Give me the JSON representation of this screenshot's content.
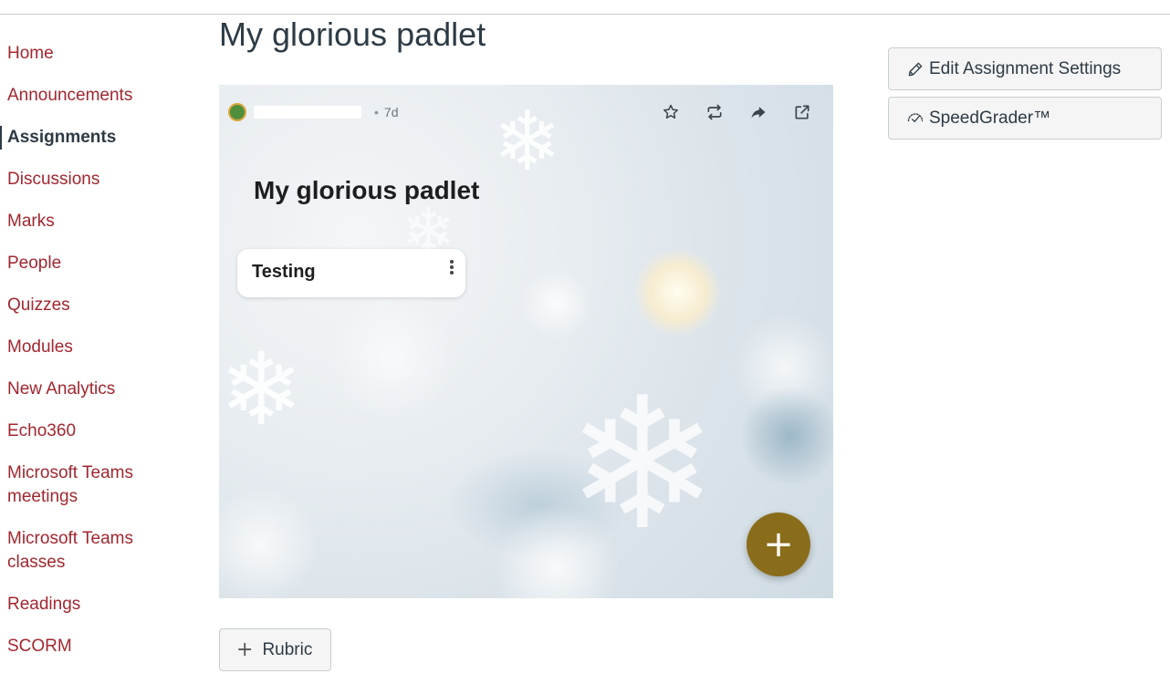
{
  "page": {
    "title": "My glorious padlet"
  },
  "sidebar": {
    "items": [
      {
        "label": "Home",
        "active": false
      },
      {
        "label": "Announcements",
        "active": false
      },
      {
        "label": "Assignments",
        "active": true
      },
      {
        "label": "Discussions",
        "active": false
      },
      {
        "label": "Marks",
        "active": false
      },
      {
        "label": "People",
        "active": false
      },
      {
        "label": "Quizzes",
        "active": false
      },
      {
        "label": "Modules",
        "active": false
      },
      {
        "label": "New Analytics",
        "active": false
      },
      {
        "label": "Echo360",
        "active": false
      },
      {
        "label": "Microsoft Teams\nmeetings",
        "active": false
      },
      {
        "label": "Microsoft Teams\nclasses",
        "active": false
      },
      {
        "label": "Readings",
        "active": false
      },
      {
        "label": "SCORM",
        "active": false
      }
    ]
  },
  "padlet": {
    "dot": "•",
    "time_ago": "7d",
    "title": "My glorious padlet",
    "card_title": "Testing",
    "fab_label": "+",
    "actions": [
      "star-icon",
      "remake-icon",
      "share-icon",
      "open-external-icon"
    ]
  },
  "buttons": {
    "edit_settings": "Edit Assignment Settings",
    "speedgrader": "SpeedGrader™",
    "rubric": "Rubric"
  },
  "colors": {
    "link": "#a3262f",
    "fab": "#8a6d1a"
  }
}
